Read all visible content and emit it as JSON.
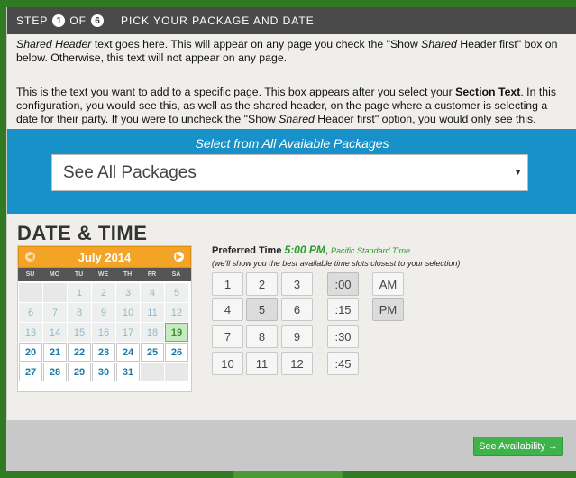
{
  "step": {
    "label": "STEP",
    "current": "1",
    "of": "OF",
    "total": "6",
    "title": "PICK YOUR PACKAGE AND DATE"
  },
  "intro": {
    "p1a": "Shared Header",
    "p1b": " text goes here. This will appear on any page you check the \"Show ",
    "p1c": "Shared",
    "p1d": " Header first\" box on below. Otherwise, this text will not appear on any page.",
    "p2a": "This is the text you want to add to a specific page. This box appears after you select your ",
    "p2b": "Section Text",
    "p2c": ". In this configuration, you would see this, as well as the shared header, on the page where a customer is selecting a date for their party. If you were to uncheck the \"Show ",
    "p2d": "Shared",
    "p2e": " Header first\" option, you would only see this."
  },
  "packages": {
    "label": "Select from All Available Packages",
    "selected": "See All Packages"
  },
  "datetime": {
    "title": "DATE & TIME"
  },
  "calendar": {
    "month": "July 2014",
    "dow": [
      "SU",
      "MO",
      "TU",
      "WE",
      "TH",
      "FR",
      "SA"
    ],
    "weeks": [
      [
        "",
        "",
        "1",
        "2",
        "3",
        "4",
        "5"
      ],
      [
        "6",
        "7",
        "8",
        "9",
        "10",
        "11",
        "12"
      ],
      [
        "13",
        "14",
        "15",
        "16",
        "17",
        "18",
        "19"
      ],
      [
        "20",
        "21",
        "22",
        "23",
        "24",
        "25",
        "26"
      ],
      [
        "27",
        "28",
        "29",
        "30",
        "31",
        "",
        ""
      ]
    ],
    "today": "19"
  },
  "time": {
    "label": "Preferred Time",
    "value": "5:00 PM",
    "tz": "Pacific Standard Time",
    "note": "(we'll show you the best available time slots closest to your selection)",
    "hours": [
      "1",
      "2",
      "3",
      "4",
      "5",
      "6",
      "7",
      "8",
      "9",
      "10",
      "11",
      "12"
    ],
    "minutes": [
      ":00",
      ":15",
      ":30",
      ":45"
    ],
    "ampm": [
      "AM",
      "PM"
    ],
    "selected_hour": "5",
    "selected_minute": ":00",
    "selected_ampm": "PM"
  },
  "footer": {
    "button": "See Availability →"
  }
}
